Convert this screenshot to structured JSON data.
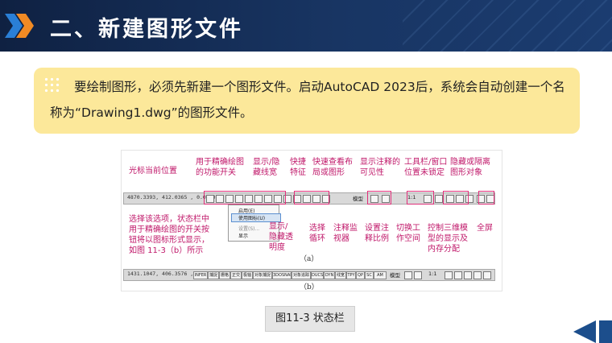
{
  "header": {
    "title": "二、新建图形文件"
  },
  "note": {
    "text": "要绘制图形，必须先新建一个图形文件。启动AutoCAD 2023后，系统会自动创建一个名称为“Drawing1.dwg”的图形文件。"
  },
  "figure": {
    "annotations_top": [
      "光标当前位置",
      "用于精确绘图的功能开关",
      "显示/隐藏线宽",
      "快捷特征",
      "快速查看布局或图形",
      "显示注释的可见性",
      "工具栏/窗口位置未锁定",
      "隐藏或隔离图形对象"
    ],
    "annotations_bottom": [
      "选择该选项，状态栏中用于精确绘图的开关按钮将以图标形式显示，如图 11-3（b）所示",
      "显示/隐藏透明度",
      "选择循环",
      "注释监视器",
      "设置注释比例",
      "切换工作空间",
      "控制三维模型的显示及内存分配",
      "全屏"
    ],
    "bar_a_coords": "4870.3393, 412.0365 , 0.0000",
    "bar_a_model": "模型",
    "bar_a_scale": "1:1",
    "context_menu": {
      "items": [
        "启用(E)",
        "使用图标(U)",
        "设置(S)...",
        "显示"
      ]
    },
    "sublabel_a": "（a）",
    "bar_b_coords": "1431.1047, 406.3576 , 0.0000",
    "bar_b_buttons": [
      "INFER",
      "捕捉",
      "栅格",
      "正交",
      "极轴",
      "对象捕捉",
      "3DOSNAP",
      "对象追踪",
      "DUCS",
      "DYN",
      "线宽",
      "TPY",
      "QP",
      "SC",
      "AM"
    ],
    "bar_b_model": "模型",
    "bar_b_scale": "1:1",
    "sublabel_b": "（b）"
  },
  "caption": "图11-3  状态栏",
  "colors": {
    "header_bg": "#12264a",
    "note_bg": "#fce89a",
    "annotation": "#c0186a",
    "accent_orange": "#f08a24",
    "nav_blue": "#1c4e8c"
  }
}
